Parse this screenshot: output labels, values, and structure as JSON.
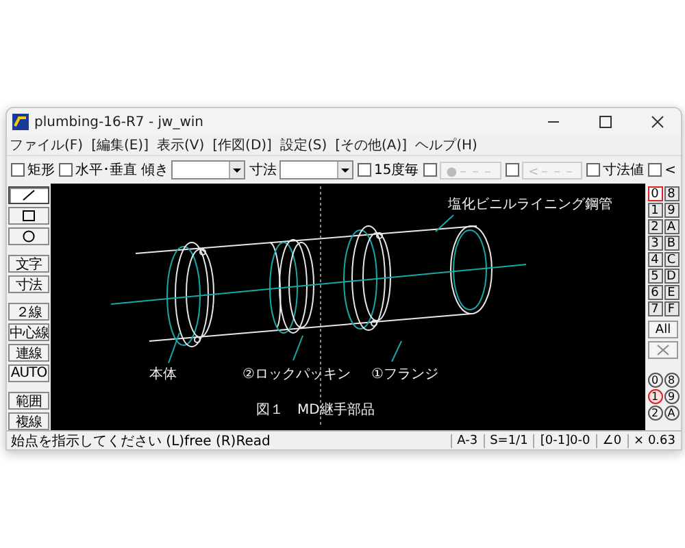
{
  "window": {
    "title": "plumbing-16-R7 - jw_win"
  },
  "menu": [
    "ファイル(F)",
    "[編集(E)]",
    "表示(V)",
    "[作図(D)]",
    "設定(S)",
    "[その他(A)]",
    "ヘルプ(H)"
  ],
  "toolbar": [
    {
      "kind": "checkbox",
      "label": "矩形",
      "checked": false
    },
    {
      "kind": "checkbox",
      "label": "水平･垂直",
      "checked": false
    },
    {
      "kind": "combo",
      "label": "傾き"
    },
    {
      "kind": "combo",
      "label": "寸法"
    },
    {
      "kind": "checkbox",
      "label": "15度毎",
      "checked": false
    },
    {
      "kind": "checkbutton",
      "checked": false,
      "button": "●－－－",
      "disabled": true
    },
    {
      "kind": "checkbutton",
      "checked": false,
      "button": "<－－－",
      "disabled": true
    },
    {
      "kind": "checkbox",
      "label": "寸法値",
      "checked": false
    },
    {
      "kind": "checkbox",
      "label": "<",
      "checked": false
    }
  ],
  "tools": [
    {
      "kind": "line",
      "selected": true
    },
    {
      "kind": "rect",
      "selected": false
    },
    {
      "kind": "circle",
      "selected": false
    },
    {
      "kind": "text",
      "label": "文字",
      "selected": false
    },
    {
      "kind": "text",
      "label": "寸法",
      "selected": false
    },
    {
      "kind": "text",
      "label": "２線",
      "selected": false
    },
    {
      "kind": "text",
      "label": "中心線",
      "selected": false
    },
    {
      "kind": "text",
      "label": "連線",
      "selected": false
    },
    {
      "kind": "text",
      "label": "AUTO",
      "selected": false
    },
    {
      "kind": "text",
      "label": "範囲",
      "selected": false
    },
    {
      "kind": "text",
      "label": "複線",
      "selected": false
    }
  ],
  "drawing": {
    "callouts": [
      "塩化ビニルライニング鋼管",
      "本体",
      "②ロックパッキン",
      "①フランジ"
    ],
    "caption": "図１　MD継手部品"
  },
  "layers": [
    {
      "label": "0",
      "selected": true
    },
    {
      "label": "8",
      "selected": false
    },
    {
      "label": "1",
      "selected": false
    },
    {
      "label": "9",
      "selected": false
    },
    {
      "label": "2",
      "selected": false
    },
    {
      "label": "A",
      "selected": false
    },
    {
      "label": "3",
      "selected": false
    },
    {
      "label": "B",
      "selected": false
    },
    {
      "label": "4",
      "selected": false
    },
    {
      "label": "C",
      "selected": false
    },
    {
      "label": "5",
      "selected": false
    },
    {
      "label": "D",
      "selected": false
    },
    {
      "label": "6",
      "selected": false
    },
    {
      "label": "E",
      "selected": false
    },
    {
      "label": "7",
      "selected": false
    },
    {
      "label": "F",
      "selected": false
    }
  ],
  "layer_all": "All",
  "groups": [
    {
      "label": "0",
      "selected": false
    },
    {
      "label": "8",
      "selected": false
    },
    {
      "label": "1",
      "selected": true
    },
    {
      "label": "9",
      "selected": false
    },
    {
      "label": "2",
      "selected": false
    },
    {
      "label": "A",
      "selected": false
    }
  ],
  "status_bar": {
    "message": "始点を指示してください (L)free (R)Read",
    "fields": [
      "A-3",
      "S=1/1",
      "[0-1]0-0",
      "∠0",
      "× 0.63"
    ]
  }
}
